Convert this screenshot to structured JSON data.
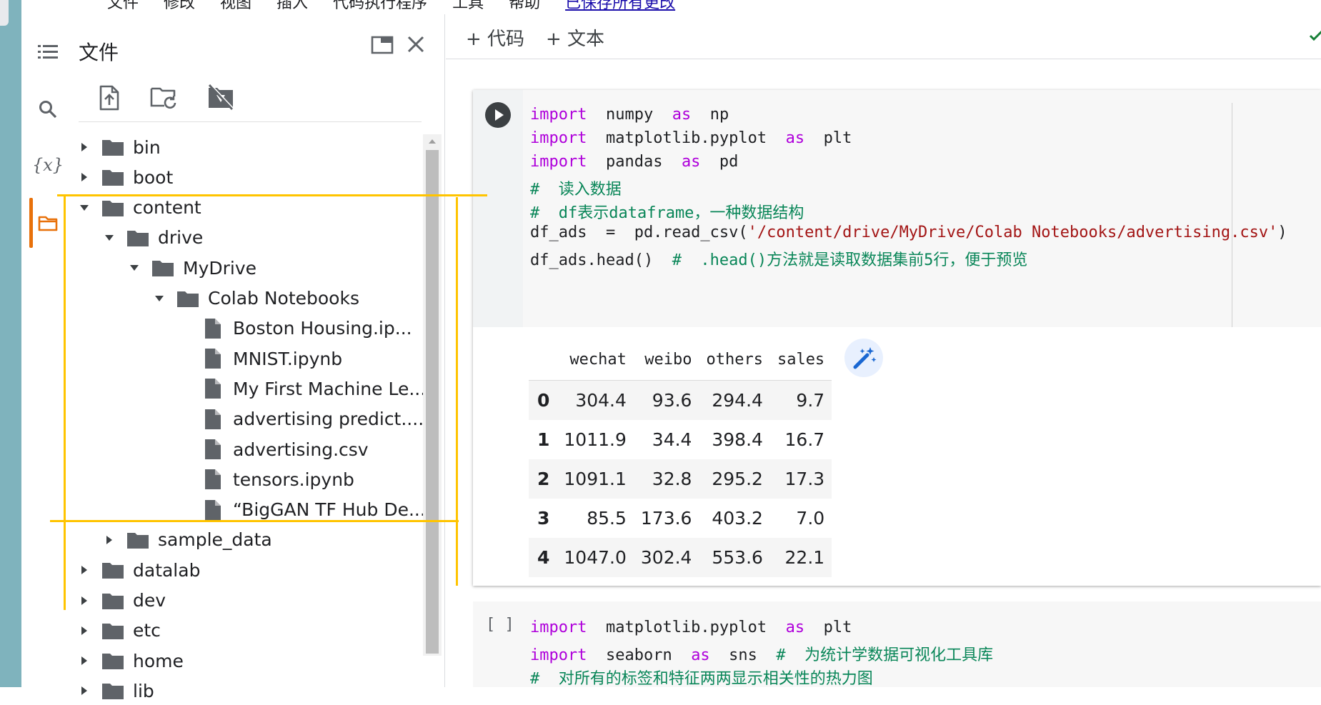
{
  "menubar": {
    "items": [
      "文件",
      "修改",
      "视图",
      "插入",
      "代码执行程序",
      "工具",
      "帮助"
    ],
    "save_link": "已保存所有更改"
  },
  "rail": {
    "icons": [
      "table-of-contents-icon",
      "search-icon",
      "variables-icon",
      "files-folder-icon"
    ],
    "variables_glyph": "{x}"
  },
  "files_panel": {
    "title": "文件",
    "tools": [
      "upload-file-icon",
      "refresh-folder-icon",
      "unmount-drive-icon"
    ],
    "tree": [
      {
        "label": "bin",
        "type": "folder",
        "depth": 0,
        "expanded": false
      },
      {
        "label": "boot",
        "type": "folder",
        "depth": 0,
        "expanded": false
      },
      {
        "label": "content",
        "type": "folder",
        "depth": 0,
        "expanded": true
      },
      {
        "label": "drive",
        "type": "folder",
        "depth": 1,
        "expanded": true
      },
      {
        "label": "MyDrive",
        "type": "folder",
        "depth": 2,
        "expanded": true
      },
      {
        "label": "Colab Notebooks",
        "type": "folder",
        "depth": 3,
        "expanded": true
      },
      {
        "label": "Boston Housing.ip...",
        "type": "file",
        "depth": 4
      },
      {
        "label": "MNIST.ipynb",
        "type": "file",
        "depth": 4
      },
      {
        "label": "My First Machine Le...",
        "type": "file",
        "depth": 4
      },
      {
        "label": "advertising predict....",
        "type": "file",
        "depth": 4
      },
      {
        "label": "advertising.csv",
        "type": "file",
        "depth": 4
      },
      {
        "label": "tensors.ipynb",
        "type": "file",
        "depth": 4
      },
      {
        "label": "“BigGAN TF Hub De...",
        "type": "file",
        "depth": 4
      },
      {
        "label": "sample_data",
        "type": "folder",
        "depth": 1,
        "expanded": false
      },
      {
        "label": "datalab",
        "type": "folder",
        "depth": 0,
        "expanded": false
      },
      {
        "label": "dev",
        "type": "folder",
        "depth": 0,
        "expanded": false
      },
      {
        "label": "etc",
        "type": "folder",
        "depth": 0,
        "expanded": false
      },
      {
        "label": "home",
        "type": "folder",
        "depth": 0,
        "expanded": false
      },
      {
        "label": "lib",
        "type": "folder",
        "depth": 0,
        "expanded": false
      }
    ]
  },
  "toolbar": {
    "add_code": "+ 代码",
    "add_text": "+ 文本"
  },
  "cell1": {
    "code_lines": [
      [
        {
          "t": "import",
          "c": "kw"
        },
        {
          "t": "  numpy  ",
          "c": ""
        },
        {
          "t": "as",
          "c": "kw"
        },
        {
          "t": "  np",
          "c": ""
        }
      ],
      [
        {
          "t": "import",
          "c": "kw"
        },
        {
          "t": "  matplotlib.pyplot  ",
          "c": ""
        },
        {
          "t": "as",
          "c": "kw"
        },
        {
          "t": "  plt",
          "c": ""
        }
      ],
      [
        {
          "t": "import",
          "c": "kw"
        },
        {
          "t": "  pandas  ",
          "c": ""
        },
        {
          "t": "as",
          "c": "kw"
        },
        {
          "t": "  pd",
          "c": ""
        }
      ],
      [
        {
          "t": "#  读入数据",
          "c": "cm"
        }
      ],
      [
        {
          "t": "#  df表示dataframe，一种数据结构",
          "c": "cm"
        }
      ],
      [
        {
          "t": "df_ads  =  pd.read_csv(",
          "c": ""
        },
        {
          "t": "'/content/drive/MyDrive/Colab Notebooks/advertising.csv'",
          "c": "str"
        },
        {
          "t": ")",
          "c": ""
        }
      ],
      [
        {
          "t": "df_ads.head()  ",
          "c": ""
        },
        {
          "t": "#  .head()方法就是读取数据集前5行，便于预览",
          "c": "cm"
        }
      ]
    ],
    "output": {
      "columns": [
        "",
        "wechat",
        "weibo",
        "others",
        "sales"
      ],
      "rows": [
        [
          "0",
          "304.4",
          "93.6",
          "294.4",
          "9.7"
        ],
        [
          "1",
          "1011.9",
          "34.4",
          "398.4",
          "16.7"
        ],
        [
          "2",
          "1091.1",
          "32.8",
          "295.2",
          "17.3"
        ],
        [
          "3",
          "85.5",
          "173.6",
          "403.2",
          "7.0"
        ],
        [
          "4",
          "1047.0",
          "302.4",
          "553.6",
          "22.1"
        ]
      ]
    }
  },
  "cell2": {
    "bracket": "[ ]",
    "code_lines": [
      [
        {
          "t": "import",
          "c": "kw"
        },
        {
          "t": "  matplotlib.pyplot  ",
          "c": ""
        },
        {
          "t": "as",
          "c": "kw"
        },
        {
          "t": "  plt",
          "c": ""
        }
      ],
      [
        {
          "t": "import",
          "c": "kw"
        },
        {
          "t": "  seaborn  ",
          "c": ""
        },
        {
          "t": "as",
          "c": "kw"
        },
        {
          "t": "  sns  ",
          "c": ""
        },
        {
          "t": "#  为统计学数据可视化工具库",
          "c": "cm"
        }
      ],
      [
        {
          "t": "#  对所有的标签和特征两两显示相关性的热力图",
          "c": "cm"
        }
      ]
    ]
  },
  "colors": {
    "accent_orange": "#e8710a",
    "annotation_yellow": "#ffc400",
    "keyword": "#af00db",
    "comment": "#098658",
    "string": "#a31515"
  }
}
